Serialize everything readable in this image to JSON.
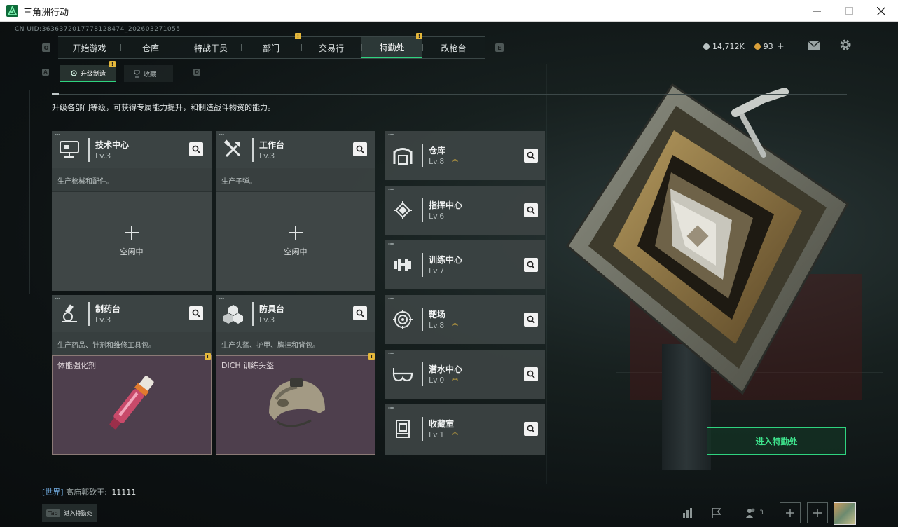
{
  "window": {
    "title": "三角洲行动",
    "minimize_icon": "minimize-icon",
    "maximize_icon": "maximize-icon",
    "close_icon": "close-icon"
  },
  "uid": "CN UID:3636372017778128474_202603271055",
  "topnav": {
    "left_key": "Q",
    "right_key": "E",
    "tabs": [
      {
        "label": "开始游戏",
        "active": false,
        "badge": ""
      },
      {
        "label": "仓库",
        "active": false,
        "badge": ""
      },
      {
        "label": "特战干员",
        "active": false,
        "badge": ""
      },
      {
        "label": "部门",
        "active": false,
        "badge": "!"
      },
      {
        "label": "交易行",
        "active": false,
        "badge": ""
      },
      {
        "label": "特勤处",
        "active": true,
        "badge": "!"
      },
      {
        "label": "改枪台",
        "active": false,
        "badge": ""
      }
    ]
  },
  "subtabs": {
    "left_key": "A",
    "right_key": "D",
    "items": [
      {
        "label": "升级制造",
        "active": true,
        "badge": "!"
      },
      {
        "label": "收藏",
        "active": false,
        "badge": ""
      }
    ]
  },
  "currency": {
    "coins": "14,712K",
    "bonds": "93",
    "bonds_add": "+",
    "coin_color": "#b9c2c2",
    "bond_color": "#d9a03a"
  },
  "description": "升级各部门等级，可获得专属能力提升，和制造战斗物资的能力。",
  "workshops": [
    {
      "name": "技术中心",
      "level": "Lv.3",
      "desc": "生产枪械和配件。",
      "state": "空闲中",
      "icon": "monitor-icon"
    },
    {
      "name": "工作台",
      "level": "Lv.3",
      "desc": "生产子弹。",
      "state": "空闲中",
      "icon": "tools-icon"
    },
    {
      "name": "制药台",
      "level": "Lv.3",
      "desc": "生产药品、针剂和维修工具包。",
      "item": "体能强化剂",
      "badge": "!",
      "icon": "microscope-icon"
    },
    {
      "name": "防具台",
      "level": "Lv.3",
      "desc": "生产头盔、护甲、胸挂和背包。",
      "item": "DICH 训练头盔",
      "badge": "!",
      "icon": "cubes-icon"
    }
  ],
  "departments": [
    {
      "name": "仓库",
      "level": "Lv.8",
      "upgrade": true,
      "icon": "warehouse-icon"
    },
    {
      "name": "指挥中心",
      "level": "Lv.6",
      "upgrade": false,
      "icon": "command-chip-icon"
    },
    {
      "name": "训练中心",
      "level": "Lv.7",
      "upgrade": false,
      "icon": "dumbbell-icon"
    },
    {
      "name": "靶场",
      "level": "Lv.8",
      "upgrade": true,
      "icon": "target-icon"
    },
    {
      "name": "潜水中心",
      "level": "Lv.0",
      "upgrade": true,
      "icon": "diving-mask-icon"
    },
    {
      "name": "收藏室",
      "level": "Lv.1",
      "upgrade": true,
      "icon": "collection-icon"
    }
  ],
  "enter_button": "进入特勤处",
  "chat": {
    "channel": "[世界]",
    "user": "高庙郭砍王:",
    "message": "11111"
  },
  "tab_hint": {
    "key": "Tab",
    "label": "进入特勤处"
  },
  "bottom_bar": {
    "squad_count": "3"
  },
  "accent_color": "#2fd37f",
  "badge_color": "#e4b73b"
}
